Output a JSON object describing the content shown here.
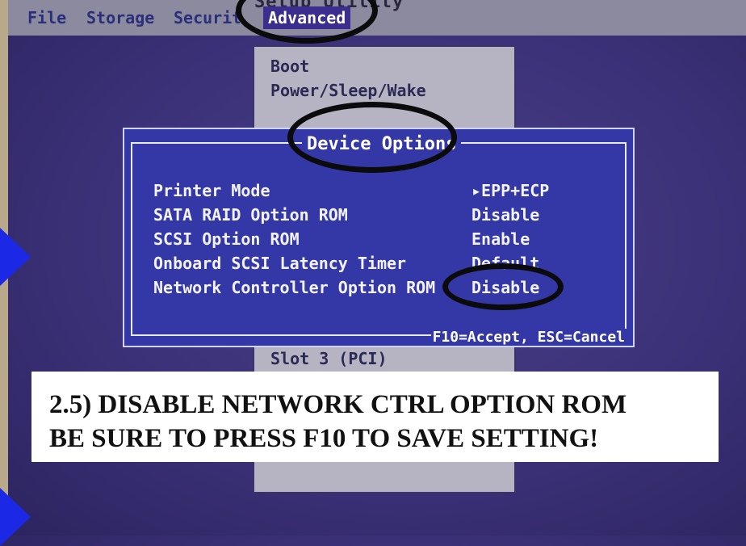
{
  "header": {
    "title_fragment": "Setup Utility",
    "menu": [
      {
        "label": "File"
      },
      {
        "label": "Storage"
      },
      {
        "label": "Security"
      },
      {
        "label": "Advanced"
      }
    ]
  },
  "dropdown": {
    "items": [
      {
        "label": "Boot"
      },
      {
        "label": "Power/Sleep/Wake"
      },
      {
        "label": "Slot 3 (PCI)"
      }
    ]
  },
  "dialog": {
    "title": "Device Options",
    "options": [
      {
        "label": "Printer Mode",
        "value": "▸EPP+ECP"
      },
      {
        "label": "SATA RAID Option ROM",
        "value": "Disable"
      },
      {
        "label": "SCSI Option ROM",
        "value": "Enable"
      },
      {
        "label": "Onboard SCSI Latency Timer",
        "value": "Default"
      },
      {
        "label": "Network Controller Option ROM",
        "value": "Disable"
      }
    ],
    "footer": "F10=Accept, ESC=Cancel"
  },
  "caption": {
    "line1": "2.5) DISABLE NETWORK CTRL OPTION ROM",
    "line2": "BE SURE TO PRESS F10 TO SAVE SETTING!"
  },
  "colors": {
    "dialog_bg": "#3437a6",
    "menu_active_bg": "#3b2e8f",
    "annotation_arrow": "#1b29e6",
    "annotation_circle": "#0b0b0b"
  }
}
